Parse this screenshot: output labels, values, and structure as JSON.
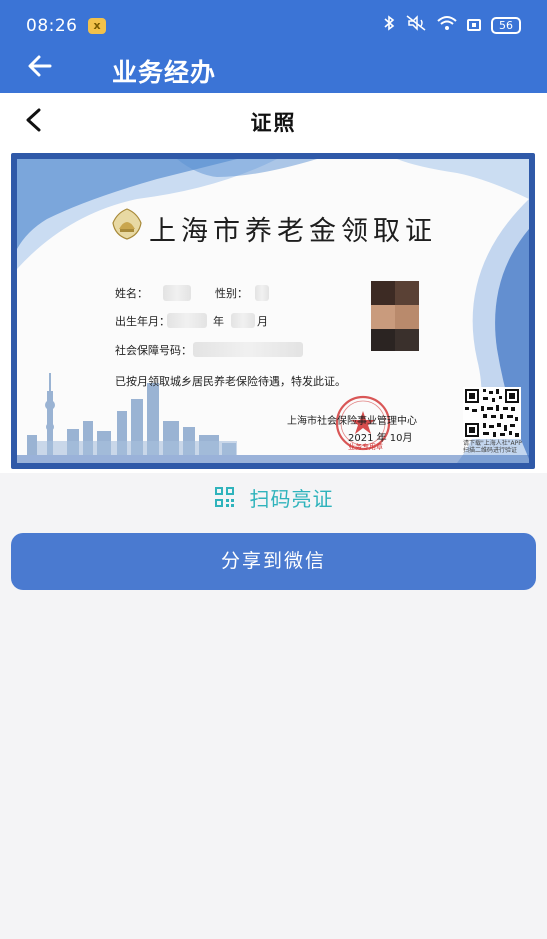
{
  "status": {
    "time": "08:26",
    "app_badge": "ⅹ",
    "battery": "56"
  },
  "appbar": {
    "title": "业务经办"
  },
  "subheader": {
    "title": "证照"
  },
  "certificate": {
    "title": "上海市养老金领取证",
    "fields": {
      "name_label": "姓名：",
      "gender_label": "性别：",
      "birth_label": "出生年月：",
      "year_unit": "年",
      "month_unit": "月",
      "ssn_label": "社会保障号码："
    },
    "statement": "已按月领取城乡居民养老保险待遇，特发此证。",
    "issuer": "上海市社会保险事业管理中心",
    "issue_date": "2021 年 10月",
    "seal_label": "业务专用章",
    "qr_caption": "请下载\"上海人社\"APP 扫描二维码进行验证"
  },
  "scan": {
    "label": "扫码亮证"
  },
  "share_button": {
    "label": "分享到微信"
  },
  "colors": {
    "brand_blue": "#3b74d6",
    "button_blue": "#4a7ad0",
    "accent_teal": "#2fb3bc"
  }
}
